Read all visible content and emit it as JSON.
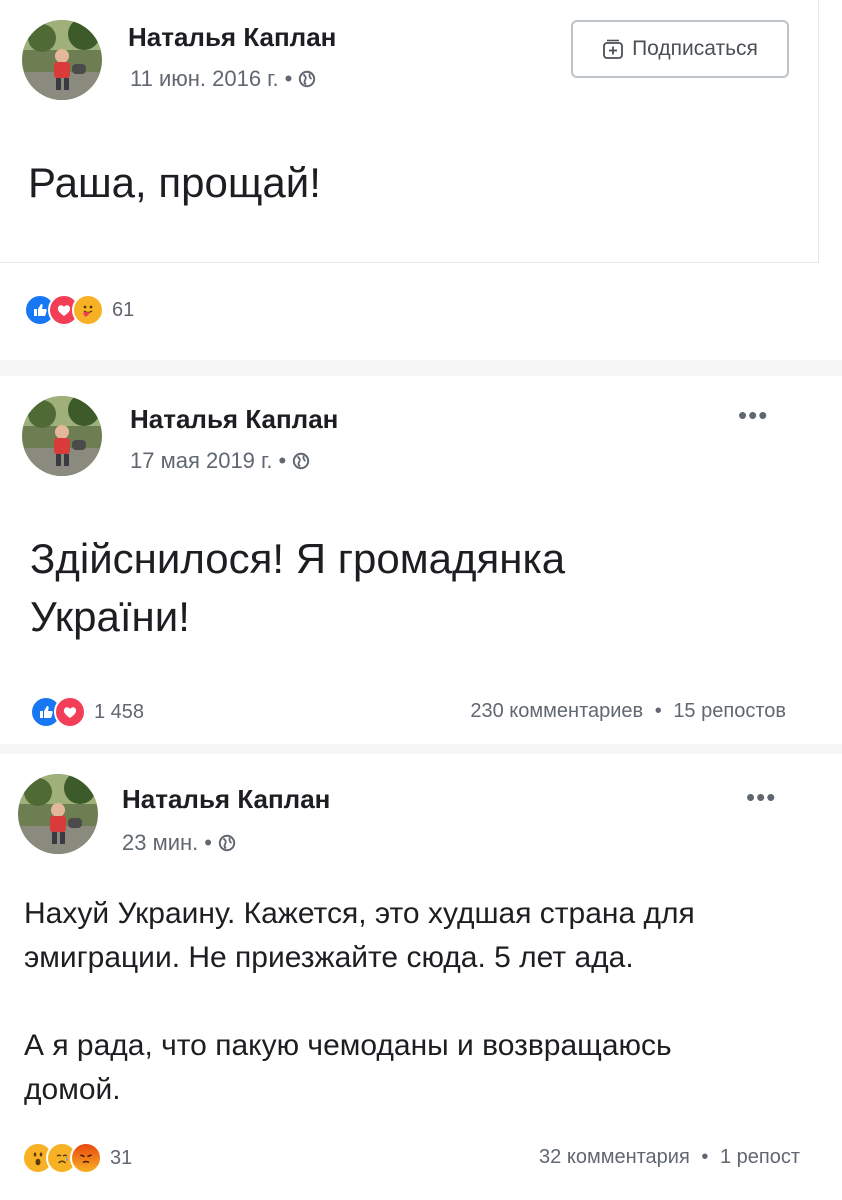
{
  "posts": [
    {
      "author": "Наталья Каплан",
      "date": "11 июн. 2016 г.",
      "subscribe_label": "Подписаться",
      "text": "Раша, прощай!",
      "reactions": [
        "like",
        "love",
        "care"
      ],
      "reactions_count": "61"
    },
    {
      "author": "Наталья Каплан",
      "date": "17 мая 2019 г.",
      "more_label": "•••",
      "text_lines": [
        "Здійснилося! Я громадянка",
        "України!"
      ],
      "reactions": [
        "like",
        "love"
      ],
      "reactions_count": "1 458",
      "comments": "230 комментариев",
      "shares": "15 репостов"
    },
    {
      "author": "Наталья Каплан",
      "date": "23 мин.",
      "more_label": "•••",
      "paragraph1_lines": [
        "Нахуй Украину. Кажется, это худшая страна для",
        "эмиграции. Не приезжайте сюда. 5 лет ада."
      ],
      "paragraph2_lines": [
        "А я рада, что пакую чемоданы и возвращаюсь",
        "домой."
      ],
      "reactions": [
        "wow",
        "sad",
        "angry"
      ],
      "reactions_count": "31",
      "comments": "32 комментария",
      "shares": "1 репост"
    }
  ],
  "separator": "•",
  "colors": {
    "like": "#1877f2",
    "love": "#f33e58",
    "care": "#f7b125",
    "wow": "#f7b125",
    "angry": "#e9710f",
    "text": "#1c1e21",
    "meta": "#606770"
  }
}
